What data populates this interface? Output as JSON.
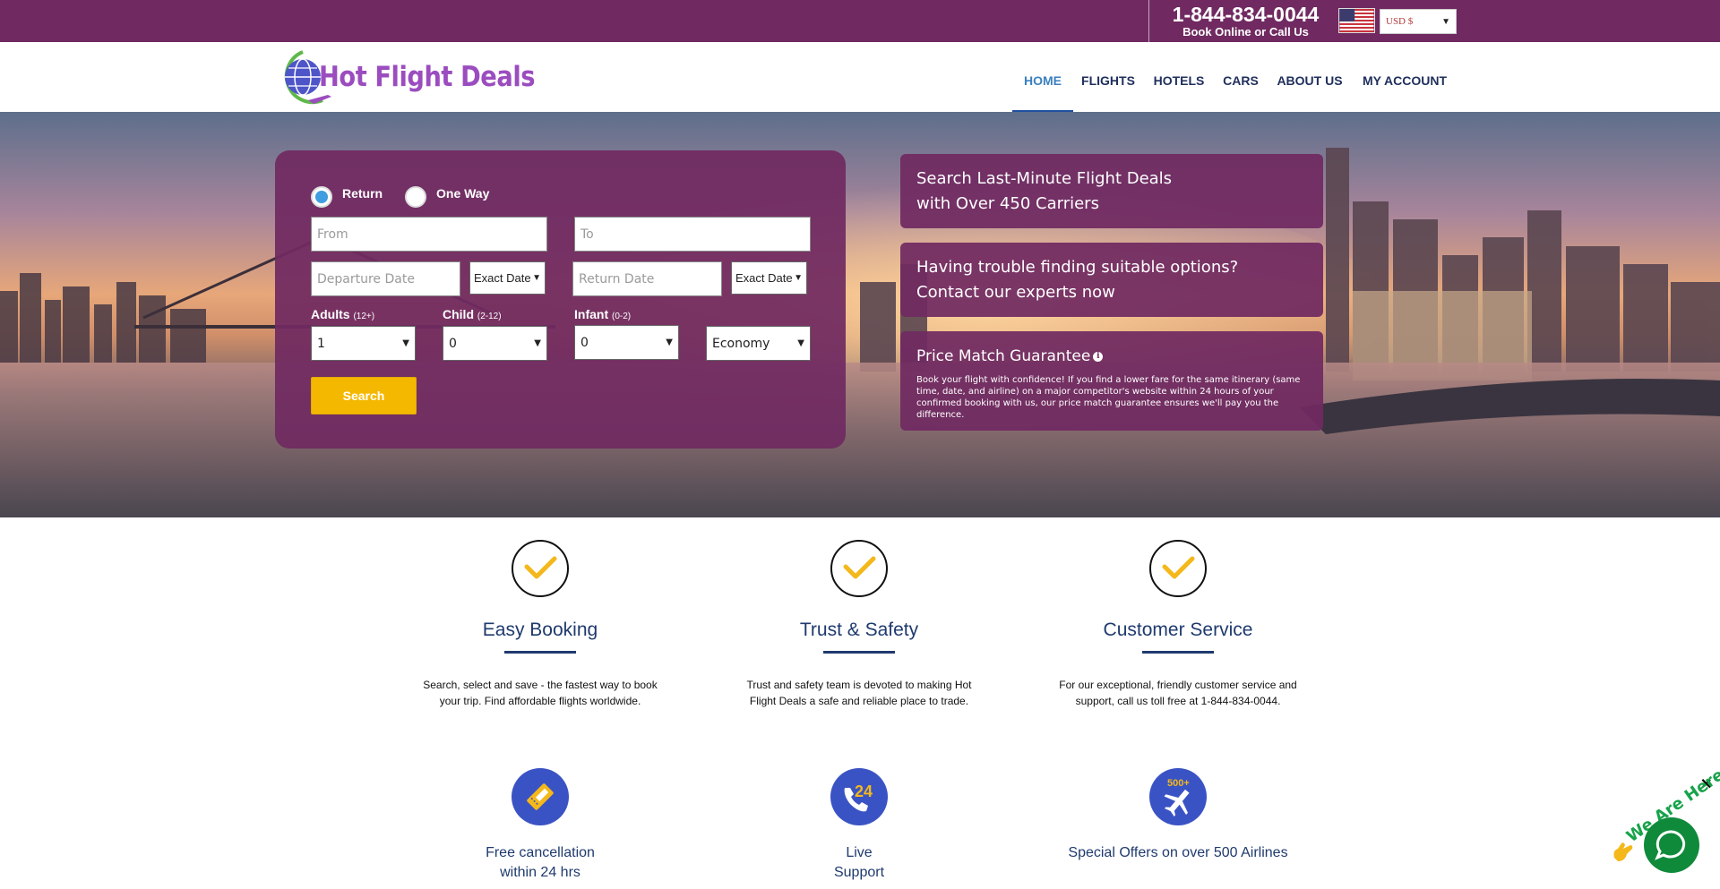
{
  "topbar": {
    "phone": "1-844-834-0044",
    "phone_sub": "Book Online or Call Us",
    "flag_icon": "us-flag-icon",
    "currency": "USD $"
  },
  "brand": {
    "name": "Hot Flight Deals",
    "logo_icon": "globe-plane-icon",
    "colors": {
      "primary": "#702a61",
      "logo": "#9b4dbf",
      "accent": "#f5b800",
      "navy": "#1f3a6e"
    }
  },
  "nav": {
    "items": [
      "HOME",
      "FLIGHTS",
      "HOTELS",
      "CARS",
      "ABOUT US",
      "MY ACCOUNT"
    ],
    "active": "HOME"
  },
  "search": {
    "trip_types": [
      "Return",
      "One Way"
    ],
    "selected_trip": "Return",
    "from_placeholder": "From",
    "to_placeholder": "To",
    "departure_placeholder": "Departure Date",
    "return_placeholder": "Return Date",
    "date_flex": "Exact Date",
    "adults_label": "Adults",
    "adults_hint": "(12+)",
    "adults_value": "1",
    "child_label": "Child",
    "child_hint": "(2-12)",
    "child_value": "0",
    "infant_label": "Infant",
    "infant_hint": "(0-2)",
    "infant_value": "0",
    "cabin": "Economy",
    "button": "Search"
  },
  "info": {
    "box1_line1": "Search Last-Minute Flight Deals",
    "box1_line2": "with Over 450 Carriers",
    "box2_line1": "Having trouble finding suitable options?",
    "box2_line2": "Contact our experts now",
    "box3_title": "Price Match Guarantee",
    "box3_text": "Book your flight with confidence! If you find a lower fare for the same itinerary (same time, date, and airline) on a major competitor's website within 24 hours of your confirmed booking with us, our price match guarantee ensures we'll pay you the difference."
  },
  "features": [
    {
      "title": "Easy Booking",
      "text": "Search, select and save - the fastest way to book your trip. Find affordable flights worldwide."
    },
    {
      "title": "Trust & Safety",
      "text": "Trust and safety team is devoted to making Hot Flight Deals a safe and reliable place to trade."
    },
    {
      "title": "Customer Service",
      "text": "For our exceptional, friendly customer service and support, call us toll free at 1-844-834-0044."
    }
  ],
  "perks": [
    {
      "line1": "Free cancellation",
      "line2": "within 24 hrs",
      "icon": "ticket-icon"
    },
    {
      "line1": "Live",
      "line2": "Support",
      "icon": "phone-24-icon",
      "badge": "24"
    },
    {
      "line1": "Special Offers on over 500 Airlines",
      "line2": "",
      "icon": "airplane-500-icon",
      "badge": "500+"
    }
  ],
  "chat": {
    "tag": "We Are Here!",
    "close": "✕"
  }
}
